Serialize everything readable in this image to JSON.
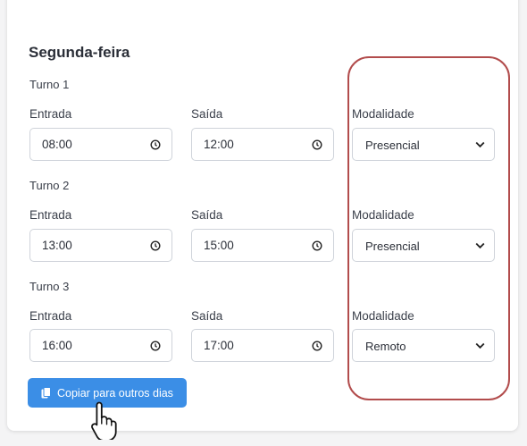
{
  "day": {
    "title": "Segunda-feira"
  },
  "labels": {
    "entrada": "Entrada",
    "saida": "Saída",
    "modalidade": "Modalidade"
  },
  "turnos": [
    {
      "label": "Turno 1",
      "entrada": "08:00",
      "saida": "12:00",
      "modalidade": "Presencial"
    },
    {
      "label": "Turno 2",
      "entrada": "13:00",
      "saida": "15:00",
      "modalidade": "Presencial"
    },
    {
      "label": "Turno 3",
      "entrada": "16:00",
      "saida": "17:00",
      "modalidade": "Remoto"
    }
  ],
  "copy_button": {
    "label": "Copiar para outros dias",
    "icon": "copy-icon"
  },
  "colors": {
    "accent": "#3b8ee6",
    "highlight": "#b24c4c"
  }
}
